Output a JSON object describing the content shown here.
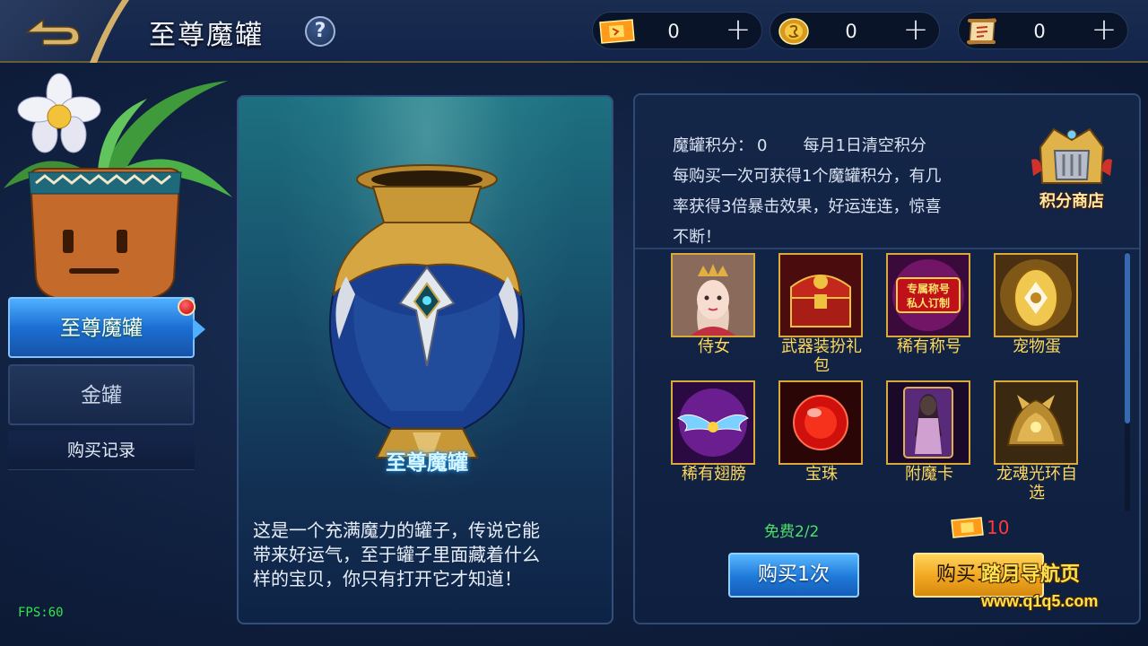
{
  "header": {
    "title": "至尊魔罐",
    "help_symbol": "?",
    "currencies": [
      {
        "icon": "coupon-icon",
        "value": "0"
      },
      {
        "icon": "gold-coin-icon",
        "value": "0"
      },
      {
        "icon": "scroll-icon",
        "value": "0"
      }
    ],
    "plus_symbol": "+"
  },
  "sidebar": {
    "tabs": [
      {
        "label": "至尊魔罐",
        "active": true,
        "notification": true
      },
      {
        "label": "金罐",
        "active": false
      }
    ],
    "history_label": "购买记录"
  },
  "jar_panel": {
    "name": "至尊魔罐",
    "description_lines": [
      "这是一个充满魔力的罐子，传说它能",
      "带来好运气，至于罐子里面藏着什么",
      "样的宝贝，你只有打开它才知道！"
    ]
  },
  "info": {
    "points_label": "魔罐积分：",
    "points_value": "0",
    "reset_note": "每月1日清空积分",
    "rule_lines": [
      "每购买一次可获得1个魔罐积分，有几",
      "率获得3倍暴击效果，好运连连，惊喜",
      "不断！"
    ]
  },
  "shop": {
    "label": "积分商店"
  },
  "rewards": {
    "items": [
      {
        "label_lines": [
          "侍女"
        ],
        "icon": "maid-portrait-icon"
      },
      {
        "label_lines": [
          "武器装扮礼",
          "包"
        ],
        "icon": "treasure-chest-icon"
      },
      {
        "label_lines": [
          "稀有称号"
        ],
        "icon": "title-badge-icon",
        "image_text": [
          "专属称号",
          "私人订制"
        ]
      },
      {
        "label_lines": [
          "宠物蛋"
        ],
        "icon": "pet-egg-icon"
      },
      {
        "label_lines": [
          "稀有翅膀"
        ],
        "icon": "wings-icon"
      },
      {
        "label_lines": [
          "宝珠"
        ],
        "icon": "orb-icon"
      },
      {
        "label_lines": [
          "附魔卡"
        ],
        "icon": "enchant-card-icon"
      },
      {
        "label_lines": [
          "龙魂光环自",
          "选"
        ],
        "icon": "dragon-aura-icon"
      }
    ]
  },
  "purchase": {
    "free_label": "免费2/2",
    "ten_cost": "10",
    "buy_once_label": "购买1次",
    "buy_ten_label": "购买10次"
  },
  "watermark": {
    "line1": "踏月导航页",
    "line2": "www.q1q5.com"
  },
  "fps": "FPS:60",
  "colors": {
    "accent_blue": "#1e78d8",
    "accent_gold": "#f1a51f",
    "item_label": "#ffd85a",
    "free_green": "#4ce06a",
    "cost_red": "#ff3a3a"
  }
}
